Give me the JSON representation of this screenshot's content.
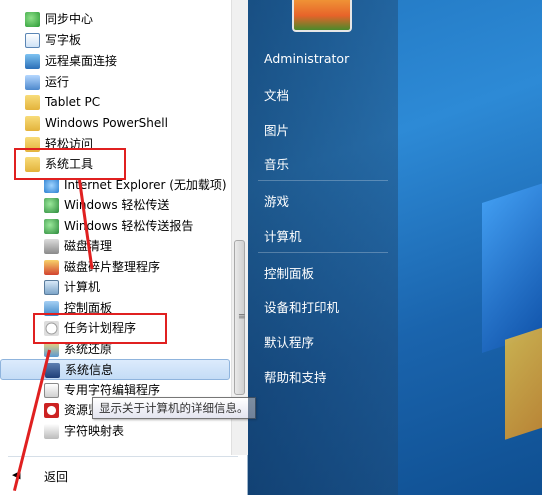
{
  "programs": {
    "items": [
      {
        "label": "同步中心",
        "icon": "sync-center-icon"
      },
      {
        "label": "写字板",
        "icon": "wordpad-icon"
      },
      {
        "label": "远程桌面连接",
        "icon": "remote-desktop-icon"
      },
      {
        "label": "运行",
        "icon": "run-icon"
      },
      {
        "label": "Tablet PC",
        "icon": "folder-icon"
      },
      {
        "label": "Windows PowerShell",
        "icon": "folder-icon"
      },
      {
        "label": "轻松访问",
        "icon": "folder-icon"
      },
      {
        "label": "系统工具",
        "icon": "folder-icon"
      }
    ],
    "sub_items": [
      {
        "label": "Internet Explorer (无加载项)",
        "icon": "internet-explorer-icon"
      },
      {
        "label": "Windows 轻松传送",
        "icon": "easy-transfer-icon"
      },
      {
        "label": "Windows 轻松传送报告",
        "icon": "easy-transfer-report-icon"
      },
      {
        "label": "磁盘清理",
        "icon": "disk-cleanup-icon"
      },
      {
        "label": "磁盘碎片整理程序",
        "icon": "disk-defrag-icon"
      },
      {
        "label": "计算机",
        "icon": "computer-icon"
      },
      {
        "label": "控制面板",
        "icon": "control-panel-icon"
      },
      {
        "label": "任务计划程序",
        "icon": "task-scheduler-icon"
      },
      {
        "label": "系统还原",
        "icon": "system-restore-icon"
      },
      {
        "label": "系统信息",
        "icon": "system-info-icon"
      },
      {
        "label": "专用字符编辑程序",
        "icon": "private-char-editor-icon"
      },
      {
        "label": "资源监视器",
        "icon": "resource-monitor-icon"
      },
      {
        "label": "字符映射表",
        "icon": "character-map-icon"
      }
    ],
    "back_label": "返回"
  },
  "tooltip": "显示关于计算机的详细信息。",
  "right_menu": [
    "Administrator",
    "文档",
    "图片",
    "音乐",
    "游戏",
    "计算机",
    "控制面板",
    "设备和打印机",
    "默认程序",
    "帮助和支持"
  ],
  "colors": {
    "highlight_red": "#e02020",
    "selection": "#c4dcf6",
    "desktop_blue": "#1d6fb8"
  }
}
